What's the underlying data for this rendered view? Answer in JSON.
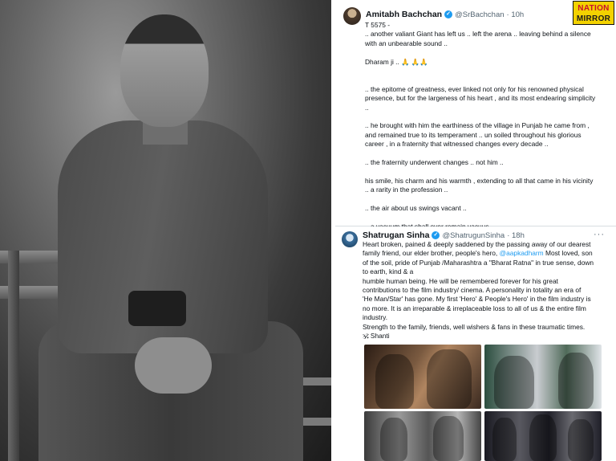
{
  "brand": {
    "line1": "NATION",
    "line2": "MIRROR"
  },
  "amitabh_post": {
    "author_name": "Amitabh Bachchan",
    "handle": "@SrBachchan",
    "time": "· 10h",
    "lines": [
      "T 5575 -",
      ".. another valiant Giant has left us .. left the arena .. leaving behind a silence",
      "with an unbearable sound ..",
      "",
      "Dharam ji .. 🙏 🙏🙏",
      "",
      "",
      ".. the epitome of greatness, ever linked not only for his renowned physical",
      "presence, but for the largeness of his heart , and its most endearing simplicity",
      "..",
      "",
      ".. he brought with him the earthiness of the village in Punjab he came from ,",
      "and remained true to its temperament .. un soiled throughout his glorious",
      "career , in a fraternity that witnessed changes every decade ..",
      "",
      ".. the fraternity underwent changes .. not him ..",
      "",
      "his smile, his charm and his warmth , extending to all that came in his vicinity",
      ".. a rarity in the profession ..",
      "",
      ".. the air about us swings vacant ..",
      "",
      ".. a vacuum that shall ever remain vacuus .."
    ]
  },
  "shatrugan_post": {
    "author_name": "Shatrugan Sinha",
    "handle": "@ShatrugunSinha",
    "time": "· 18h",
    "more": "···",
    "line1": "Heart broken, pained & deeply saddened by the passing away of our dearest",
    "line2_pre": "family friend, our elder brother, people's hero, ",
    "line2_mention": "@aapkadharm",
    "line2_post": " Most loved, son",
    "lines_rest": [
      "of the soil, pride of Punjab /Maharashtra a \"Bharat Ratna\" in true sense, down",
      "to earth, kind & a",
      "humble human being. He will be remembered forever for his great",
      "contributions to the film industry/ cinema. A personality in totality an era of",
      "'He Man/Star' has gone. My first 'Hero' & People's Hero' in the film industry is",
      "no more. It is an irreparable & irreplaceable loss to all of us & the entire film",
      "industry.",
      "Strength to the family, friends, well wishers & fans in these traumatic times.",
      "🕉 Shanti"
    ]
  },
  "colors": {
    "accent": "#1d9bf0",
    "brand_yellow": "#f3d200",
    "brand_red": "#c8102e"
  }
}
